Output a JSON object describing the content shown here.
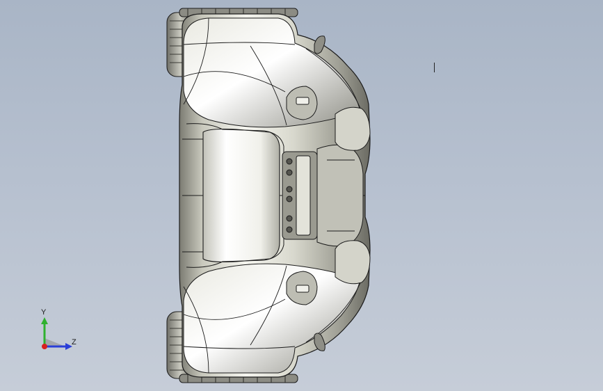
{
  "viewport": {
    "background_top": "#a9b5c6",
    "background_bottom": "#c6cdd8"
  },
  "model": {
    "name": "atv-body-top-view",
    "body_color": "#cfcfc4",
    "highlight_color": "#f4f4ee",
    "shadow_color": "#6d6d66",
    "tire_color": "#8c8c84",
    "line_color": "#1b1b1b"
  },
  "triad": {
    "y_label": "Y",
    "z_label": "Z",
    "y_color": "#2fb12f",
    "z_color": "#2a3fd8",
    "x_color": "#d82020"
  }
}
